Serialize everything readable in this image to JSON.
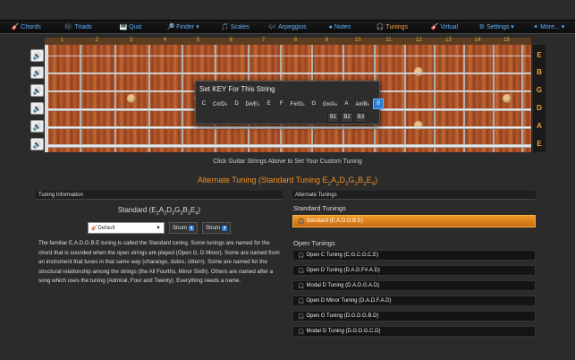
{
  "nav": [
    {
      "label": "Chords",
      "icon": "guitar-icon",
      "glyph": "🎸",
      "active": false
    },
    {
      "label": "Triads",
      "icon": "triads-icon",
      "glyph": "🎼",
      "active": false
    },
    {
      "label": "Quiz",
      "icon": "quiz-icon",
      "glyph": "🎹",
      "active": false
    },
    {
      "label": "Finder ▾",
      "icon": "finder-icon",
      "glyph": "🔎",
      "active": false
    },
    {
      "label": "Scales",
      "icon": "scales-icon",
      "glyph": "🎵",
      "active": false
    },
    {
      "label": "Arpeggios",
      "icon": "arpeggios-icon",
      "glyph": "🎶",
      "active": false
    },
    {
      "label": "Notes",
      "icon": "notes-icon",
      "glyph": "●",
      "active": false
    },
    {
      "label": "Tunings",
      "icon": "headphones-icon",
      "glyph": "🎧",
      "active": true
    },
    {
      "label": "Virtual",
      "icon": "virtual-guitar-icon",
      "glyph": "🎸",
      "active": false
    },
    {
      "label": "Settings ▾",
      "icon": "gear-icon",
      "glyph": "⚙",
      "active": false
    },
    {
      "label": "More... ▾",
      "icon": "more-icon",
      "glyph": "✦",
      "active": false
    }
  ],
  "fret_numbers": [
    "1",
    "2",
    "3",
    "4",
    "5",
    "6",
    "7",
    "8",
    "9",
    "10",
    "11",
    "12",
    "13",
    "14",
    "15"
  ],
  "string_notes": [
    "E",
    "B",
    "G",
    "D",
    "A",
    "E"
  ],
  "speaker_icon": "speaker-icon",
  "popup": {
    "title": "Set KEY For This String",
    "keys_row1": [
      "C",
      "C#/D♭",
      "D",
      "D#/E♭",
      "E",
      "F",
      "F#/G♭",
      "G",
      "G#/A♭",
      "A",
      "A#/B♭",
      "B"
    ],
    "selected_row1": "B",
    "keys_row2": [
      "B1",
      "B2",
      "B3"
    ],
    "selected_row2": "B3"
  },
  "hint": "Click Guitar Strings Above to Set Your Custom Tuning",
  "alt_title": "Alternate Tuning (Standard Tuning E2A2D3G3B3E4)",
  "left_panel": {
    "header": "Tuning Information",
    "title": "Standard (E2A2D3G3B3E4)",
    "select_value": "Default",
    "strum_labels": [
      "Strum",
      "Strum"
    ],
    "description": "The familiar E.A.D.G.B.E tuning is called the Standard tuning. Some tunings are named for the chord that is sounded when the open strings are played (Open G, D Minor). Some are named from an instrument that tunes in that same way (charango, dobro, cittern). Some are named for the structural relationship among the strings (the All Fourths, Minor Sixth). Others are named after a song which uses the tuning (Admiral, Four and Twenty). Everything needs a name."
  },
  "right_panel": {
    "header": "Alternate Tunings",
    "section1": "Standard Tunings",
    "selected": "Standard (E.A.D.G.B.E)",
    "section2": "Open Tunings",
    "open_tunings": [
      "Open C Tuning (C.G.C.G.C.E)",
      "Open D Tuning (D.A.D.F#.A.D)",
      "Modal D Tuning (D.A.D.G.A.D)",
      "Open D Minor Tuning (D.A.D.F.A.D)",
      "Open G Tuning (D.G.D.G.B.D)",
      "Modal G Tuning (D.G.D.G.C.D)"
    ]
  }
}
